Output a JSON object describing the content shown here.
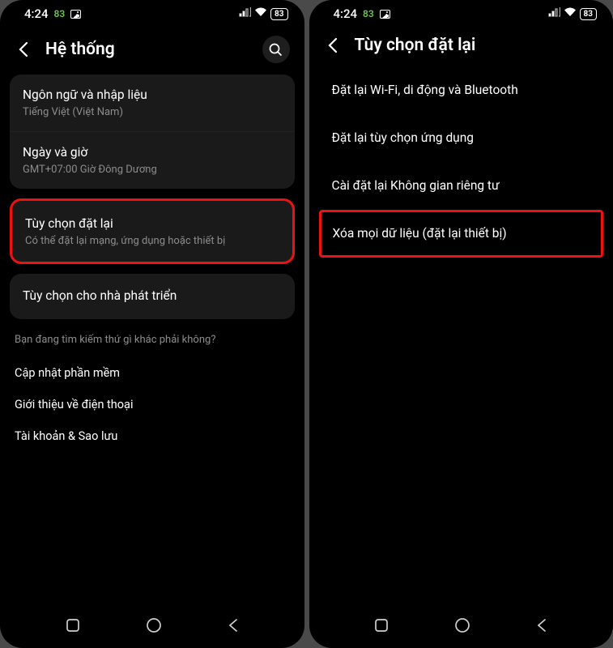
{
  "status": {
    "time": "4:24",
    "tag": "83",
    "battery": "83"
  },
  "screen1": {
    "title": "Hệ thống",
    "group1": [
      {
        "title": "Ngôn ngữ và nhập liệu",
        "sub": "Tiếng Việt (Việt Nam)"
      },
      {
        "title": "Ngày và giờ",
        "sub": "GMT+07:00 Giờ Đông Dương"
      }
    ],
    "highlight": {
      "title": "Tùy chọn đặt lại",
      "sub": "Có thể đặt lại mạng, ứng dụng hoặc thiết bị"
    },
    "dev": {
      "title": "Tùy chọn cho nhà phát triển"
    },
    "hint": "Bạn đang tìm kiếm thứ gì khác phải không?",
    "links": [
      "Cập nhật phần mềm",
      "Giới thiệu về điện thoại",
      "Tài khoản & Sao lưu"
    ]
  },
  "screen2": {
    "title": "Tùy chọn đặt lại",
    "items": [
      "Đặt lại Wi-Fi, di động và Bluetooth",
      "Đặt lại tùy chọn ứng dụng",
      "Cài đặt lại Không gian riêng tư"
    ],
    "highlight_item": "Xóa mọi dữ liệu (đặt lại thiết bị)"
  }
}
